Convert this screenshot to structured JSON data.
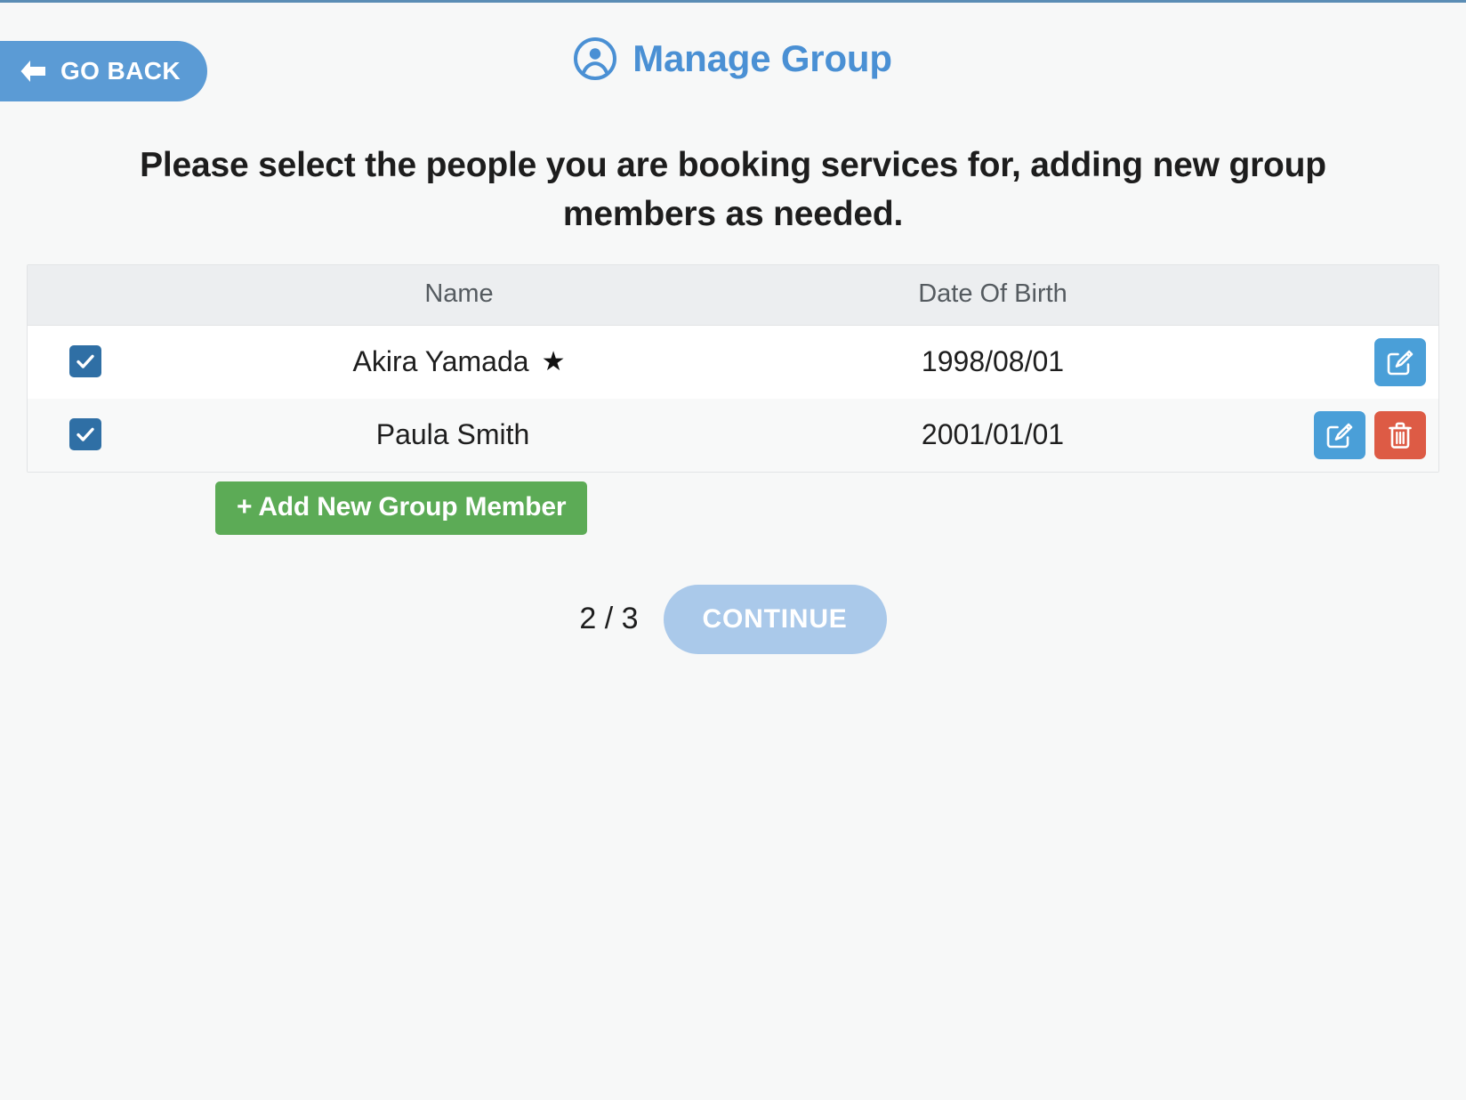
{
  "header": {
    "go_back_label": "GO BACK",
    "back_icon": "arrow-left-icon",
    "title": "Manage Group",
    "title_icon": "user-circle-icon",
    "title_color": "#4a90d4",
    "accent_color": "#5b9bd5"
  },
  "instructions": "Please select the people you are booking services for, adding new group members as needed.",
  "table": {
    "columns": [
      "",
      "Name",
      "Date Of Birth",
      ""
    ],
    "header_name": "Name",
    "header_dob": "Date Of Birth",
    "rows": [
      {
        "selected": true,
        "checkbox_icon": "check-icon",
        "name": "Akira Yamada",
        "primary_marker": "★",
        "dob": "1998/08/01",
        "actions": [
          "edit"
        ]
      },
      {
        "selected": true,
        "checkbox_icon": "check-icon",
        "name": "Paula Smith",
        "primary_marker": "",
        "dob": "2001/01/01",
        "actions": [
          "edit",
          "delete"
        ]
      }
    ]
  },
  "add_member": {
    "label": "+ Add New Group Member",
    "color": "#5cab56"
  },
  "footer": {
    "step_counter": "2 / 3",
    "continue_label": "CONTINUE",
    "continue_color": "#aac9ea"
  },
  "colors": {
    "edit_button": "#4a9fd8",
    "delete_button": "#dd5b45",
    "checkbox": "#2f6fa5",
    "table_header_bg": "#eceef0",
    "page_bg": "#f7f8f8"
  }
}
